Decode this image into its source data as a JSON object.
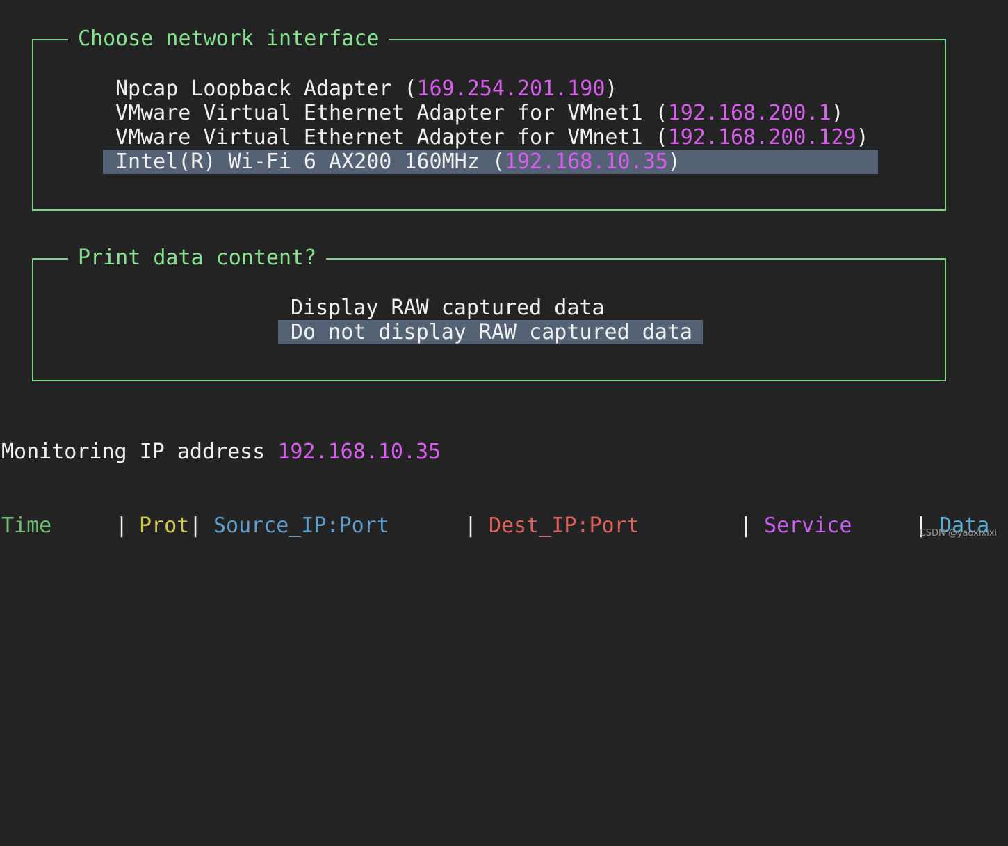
{
  "interface_panel": {
    "title": "Choose network interface",
    "items": [
      {
        "name": "Npcap Loopback Adapter",
        "open": " (",
        "ip": "169.254.201.190",
        "close": ")",
        "selected": false
      },
      {
        "name": "VMware Virtual Ethernet Adapter for VMnet1",
        "open": " (",
        "ip": "192.168.200.1",
        "close": ")",
        "selected": false
      },
      {
        "name": "VMware Virtual Ethernet Adapter for VMnet1",
        "open": " (",
        "ip": "192.168.200.129",
        "close": ")",
        "selected": false
      },
      {
        "name": "Intel(R) Wi-Fi 6 AX200 160MHz",
        "open": " (",
        "ip": "192.168.10.35",
        "close": ")",
        "selected": true
      }
    ]
  },
  "print_panel": {
    "title": "Print data content?",
    "options": [
      {
        "label": "Display RAW captured data",
        "selected": false
      },
      {
        "label": "Do not display RAW captured data",
        "selected": true
      }
    ]
  },
  "monitoring": {
    "label": "Monitoring IP address ",
    "ip": "192.168.10.35"
  },
  "table_header": {
    "separator": "|",
    "columns": [
      "Time",
      "Prot",
      "Source_IP:Port",
      "Dest_IP:Port",
      "Service",
      "Data"
    ]
  },
  "watermark": "CSDN @yaoxixixi",
  "colors": {
    "background": "#232323",
    "border": "#79d483",
    "ip": "#d95ef0",
    "selection": "#556275"
  }
}
